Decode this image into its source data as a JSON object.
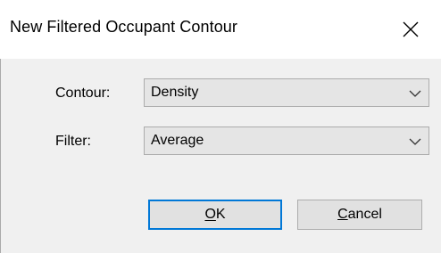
{
  "dialog": {
    "title": "New Filtered Occupant Contour"
  },
  "form": {
    "contour_label": "Contour:",
    "contour_value": "Density",
    "filter_label": "Filter:",
    "filter_value": "Average"
  },
  "buttons": {
    "ok_label": "OK",
    "cancel_label": "Cancel"
  },
  "icons": {
    "close": "close-icon",
    "dropdown": "chevron-down-icon"
  },
  "colors": {
    "accent": "#0078d7",
    "title_bg": "#ffffff",
    "body_bg": "#f0f0f0"
  }
}
